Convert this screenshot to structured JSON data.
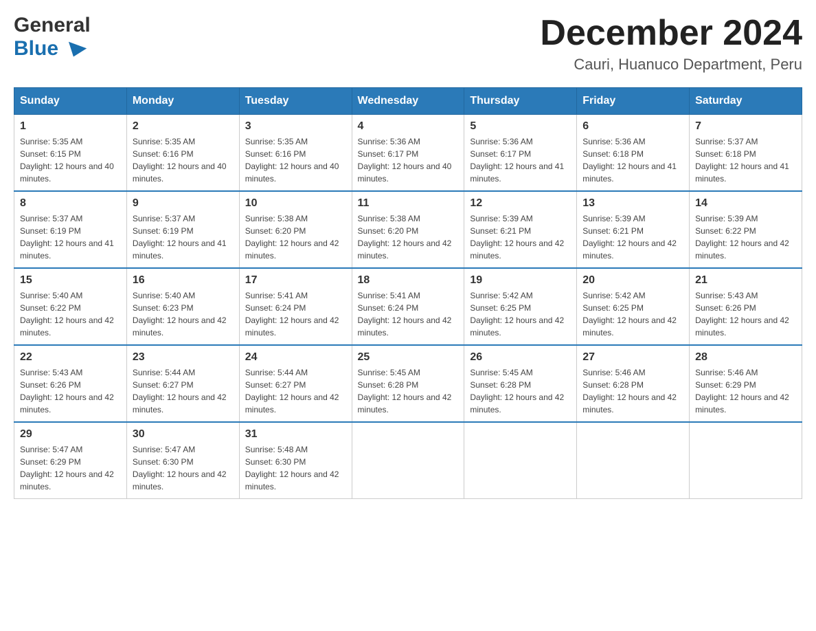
{
  "logo": {
    "line1": "General",
    "line2": "Blue"
  },
  "header": {
    "month_year": "December 2024",
    "location": "Cauri, Huanuco Department, Peru"
  },
  "days_of_week": [
    "Sunday",
    "Monday",
    "Tuesday",
    "Wednesday",
    "Thursday",
    "Friday",
    "Saturday"
  ],
  "weeks": [
    [
      {
        "day": "1",
        "sunrise": "Sunrise: 5:35 AM",
        "sunset": "Sunset: 6:15 PM",
        "daylight": "Daylight: 12 hours and 40 minutes."
      },
      {
        "day": "2",
        "sunrise": "Sunrise: 5:35 AM",
        "sunset": "Sunset: 6:16 PM",
        "daylight": "Daylight: 12 hours and 40 minutes."
      },
      {
        "day": "3",
        "sunrise": "Sunrise: 5:35 AM",
        "sunset": "Sunset: 6:16 PM",
        "daylight": "Daylight: 12 hours and 40 minutes."
      },
      {
        "day": "4",
        "sunrise": "Sunrise: 5:36 AM",
        "sunset": "Sunset: 6:17 PM",
        "daylight": "Daylight: 12 hours and 40 minutes."
      },
      {
        "day": "5",
        "sunrise": "Sunrise: 5:36 AM",
        "sunset": "Sunset: 6:17 PM",
        "daylight": "Daylight: 12 hours and 41 minutes."
      },
      {
        "day": "6",
        "sunrise": "Sunrise: 5:36 AM",
        "sunset": "Sunset: 6:18 PM",
        "daylight": "Daylight: 12 hours and 41 minutes."
      },
      {
        "day": "7",
        "sunrise": "Sunrise: 5:37 AM",
        "sunset": "Sunset: 6:18 PM",
        "daylight": "Daylight: 12 hours and 41 minutes."
      }
    ],
    [
      {
        "day": "8",
        "sunrise": "Sunrise: 5:37 AM",
        "sunset": "Sunset: 6:19 PM",
        "daylight": "Daylight: 12 hours and 41 minutes."
      },
      {
        "day": "9",
        "sunrise": "Sunrise: 5:37 AM",
        "sunset": "Sunset: 6:19 PM",
        "daylight": "Daylight: 12 hours and 41 minutes."
      },
      {
        "day": "10",
        "sunrise": "Sunrise: 5:38 AM",
        "sunset": "Sunset: 6:20 PM",
        "daylight": "Daylight: 12 hours and 42 minutes."
      },
      {
        "day": "11",
        "sunrise": "Sunrise: 5:38 AM",
        "sunset": "Sunset: 6:20 PM",
        "daylight": "Daylight: 12 hours and 42 minutes."
      },
      {
        "day": "12",
        "sunrise": "Sunrise: 5:39 AM",
        "sunset": "Sunset: 6:21 PM",
        "daylight": "Daylight: 12 hours and 42 minutes."
      },
      {
        "day": "13",
        "sunrise": "Sunrise: 5:39 AM",
        "sunset": "Sunset: 6:21 PM",
        "daylight": "Daylight: 12 hours and 42 minutes."
      },
      {
        "day": "14",
        "sunrise": "Sunrise: 5:39 AM",
        "sunset": "Sunset: 6:22 PM",
        "daylight": "Daylight: 12 hours and 42 minutes."
      }
    ],
    [
      {
        "day": "15",
        "sunrise": "Sunrise: 5:40 AM",
        "sunset": "Sunset: 6:22 PM",
        "daylight": "Daylight: 12 hours and 42 minutes."
      },
      {
        "day": "16",
        "sunrise": "Sunrise: 5:40 AM",
        "sunset": "Sunset: 6:23 PM",
        "daylight": "Daylight: 12 hours and 42 minutes."
      },
      {
        "day": "17",
        "sunrise": "Sunrise: 5:41 AM",
        "sunset": "Sunset: 6:24 PM",
        "daylight": "Daylight: 12 hours and 42 minutes."
      },
      {
        "day": "18",
        "sunrise": "Sunrise: 5:41 AM",
        "sunset": "Sunset: 6:24 PM",
        "daylight": "Daylight: 12 hours and 42 minutes."
      },
      {
        "day": "19",
        "sunrise": "Sunrise: 5:42 AM",
        "sunset": "Sunset: 6:25 PM",
        "daylight": "Daylight: 12 hours and 42 minutes."
      },
      {
        "day": "20",
        "sunrise": "Sunrise: 5:42 AM",
        "sunset": "Sunset: 6:25 PM",
        "daylight": "Daylight: 12 hours and 42 minutes."
      },
      {
        "day": "21",
        "sunrise": "Sunrise: 5:43 AM",
        "sunset": "Sunset: 6:26 PM",
        "daylight": "Daylight: 12 hours and 42 minutes."
      }
    ],
    [
      {
        "day": "22",
        "sunrise": "Sunrise: 5:43 AM",
        "sunset": "Sunset: 6:26 PM",
        "daylight": "Daylight: 12 hours and 42 minutes."
      },
      {
        "day": "23",
        "sunrise": "Sunrise: 5:44 AM",
        "sunset": "Sunset: 6:27 PM",
        "daylight": "Daylight: 12 hours and 42 minutes."
      },
      {
        "day": "24",
        "sunrise": "Sunrise: 5:44 AM",
        "sunset": "Sunset: 6:27 PM",
        "daylight": "Daylight: 12 hours and 42 minutes."
      },
      {
        "day": "25",
        "sunrise": "Sunrise: 5:45 AM",
        "sunset": "Sunset: 6:28 PM",
        "daylight": "Daylight: 12 hours and 42 minutes."
      },
      {
        "day": "26",
        "sunrise": "Sunrise: 5:45 AM",
        "sunset": "Sunset: 6:28 PM",
        "daylight": "Daylight: 12 hours and 42 minutes."
      },
      {
        "day": "27",
        "sunrise": "Sunrise: 5:46 AM",
        "sunset": "Sunset: 6:28 PM",
        "daylight": "Daylight: 12 hours and 42 minutes."
      },
      {
        "day": "28",
        "sunrise": "Sunrise: 5:46 AM",
        "sunset": "Sunset: 6:29 PM",
        "daylight": "Daylight: 12 hours and 42 minutes."
      }
    ],
    [
      {
        "day": "29",
        "sunrise": "Sunrise: 5:47 AM",
        "sunset": "Sunset: 6:29 PM",
        "daylight": "Daylight: 12 hours and 42 minutes."
      },
      {
        "day": "30",
        "sunrise": "Sunrise: 5:47 AM",
        "sunset": "Sunset: 6:30 PM",
        "daylight": "Daylight: 12 hours and 42 minutes."
      },
      {
        "day": "31",
        "sunrise": "Sunrise: 5:48 AM",
        "sunset": "Sunset: 6:30 PM",
        "daylight": "Daylight: 12 hours and 42 minutes."
      },
      null,
      null,
      null,
      null
    ]
  ]
}
